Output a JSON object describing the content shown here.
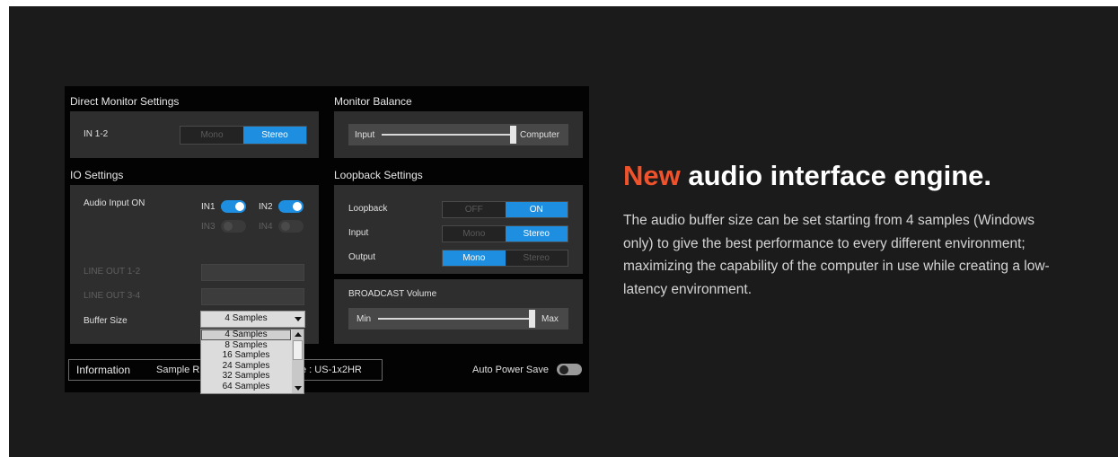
{
  "screenshot": {
    "direct_monitor": {
      "title": "Direct Monitor Settings",
      "row_label": "IN 1-2",
      "options": [
        "Mono",
        "Stereo"
      ],
      "selected": "Stereo"
    },
    "monitor_balance": {
      "title": "Monitor Balance",
      "left_label": "Input",
      "right_label": "Computer",
      "level": 0.97
    },
    "io_settings": {
      "title": "IO Settings",
      "audio_input_label": "Audio Input ON",
      "inputs": [
        {
          "label": "IN1",
          "on": true
        },
        {
          "label": "IN2",
          "on": true
        },
        {
          "label": "IN3",
          "on": false
        },
        {
          "label": "IN4",
          "on": false
        }
      ],
      "line_out_1": "LINE OUT 1-2",
      "line_out_2": "LINE OUT 3-4",
      "buffer_label": "Buffer Size",
      "buffer_value": "4 Samples",
      "buffer_options": [
        "4 Samples",
        "8 Samples",
        "16 Samples",
        "24 Samples",
        "32 Samples",
        "64 Samples"
      ]
    },
    "loopback": {
      "title": "Loopback Settings",
      "rows": [
        {
          "label": "Loopback",
          "options": [
            "OFF",
            "ON"
          ],
          "selected": "ON"
        },
        {
          "label": "Input",
          "options": [
            "Mono",
            "Stereo"
          ],
          "selected": "Stereo"
        },
        {
          "label": "Output",
          "options": [
            "Mono",
            "Stereo"
          ],
          "selected": "Mono"
        }
      ],
      "broadcast_title": "BROADCAST Volume",
      "broadcast_min": "Min",
      "broadcast_max": "Max",
      "broadcast_level": 0.97
    },
    "info": {
      "label": "Information",
      "sample_rate_partial": "Sample R",
      "device_partial": "e : US-1x2HR",
      "auto_power_label": "Auto Power Save",
      "auto_power_on": false
    }
  },
  "headline": {
    "accent": "New",
    "rest": " audio interface engine."
  },
  "description": "The audio buffer size can be set starting from 4 samples (Windows only) to give the best performance to every different environment; maximizing the capability of the computer in use while creating a low-latency environment.",
  "colors": {
    "accent": "#f0522b",
    "active_blue": "#1e8ee0",
    "background": "#1b1b1b"
  }
}
